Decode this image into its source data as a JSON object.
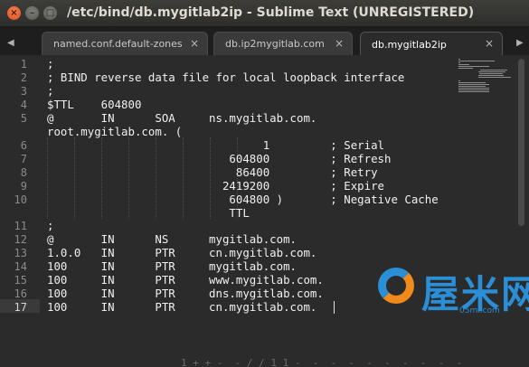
{
  "window": {
    "title": "/etc/bind/db.mygitlab2ip - Sublime Text (UNREGISTERED)",
    "close_glyph": "×",
    "min_glyph": "–",
    "max_glyph": "□"
  },
  "tabs": [
    {
      "label": "named.conf.default-zones",
      "close": "×",
      "active": false
    },
    {
      "label": "db.ip2mygitlab.com",
      "close": "×",
      "active": false
    },
    {
      "label": "db.mygitlab2ip",
      "close": "×",
      "active": true
    }
  ],
  "tab_nav": {
    "left": "◀",
    "right": "▶"
  },
  "editor": {
    "line_numbers": [
      "1",
      "2",
      "3",
      "4",
      "5",
      "",
      "6",
      "7",
      "8",
      "9",
      "10",
      "",
      "11",
      "12",
      "13",
      "14",
      "15",
      "16",
      "17"
    ],
    "current_line": "17",
    "lines": [
      ";",
      "; BIND reverse data file for local loopback interface",
      ";",
      "$TTL    604800",
      "@       IN      SOA     ns.mygitlab.com.",
      "root.mygitlab.com. (",
      "                                1         ; Serial",
      "                           604800         ; Refresh",
      "                            86400         ; Retry",
      "                          2419200         ; Expire",
      "                           604800 )       ; Negative Cache",
      "                           TTL",
      ";",
      "@       IN      NS      mygitlab.com.",
      "1.0.0   IN      PTR     cn.mygitlab.com.",
      "100     IN      PTR     mygitlab.com.",
      "100     IN      PTR     www.mygitlab.com.",
      "100     IN      PTR     dns.mygitlab.com.",
      "100     IN      PTR     cn.mygitlab.com."
    ],
    "status_fragment": "1 + + -  - / / 1 1 -  -  -  -  -  -  -  -  -  -"
  },
  "watermark": {
    "brand": "屋米网",
    "sub": "05mi.com"
  }
}
